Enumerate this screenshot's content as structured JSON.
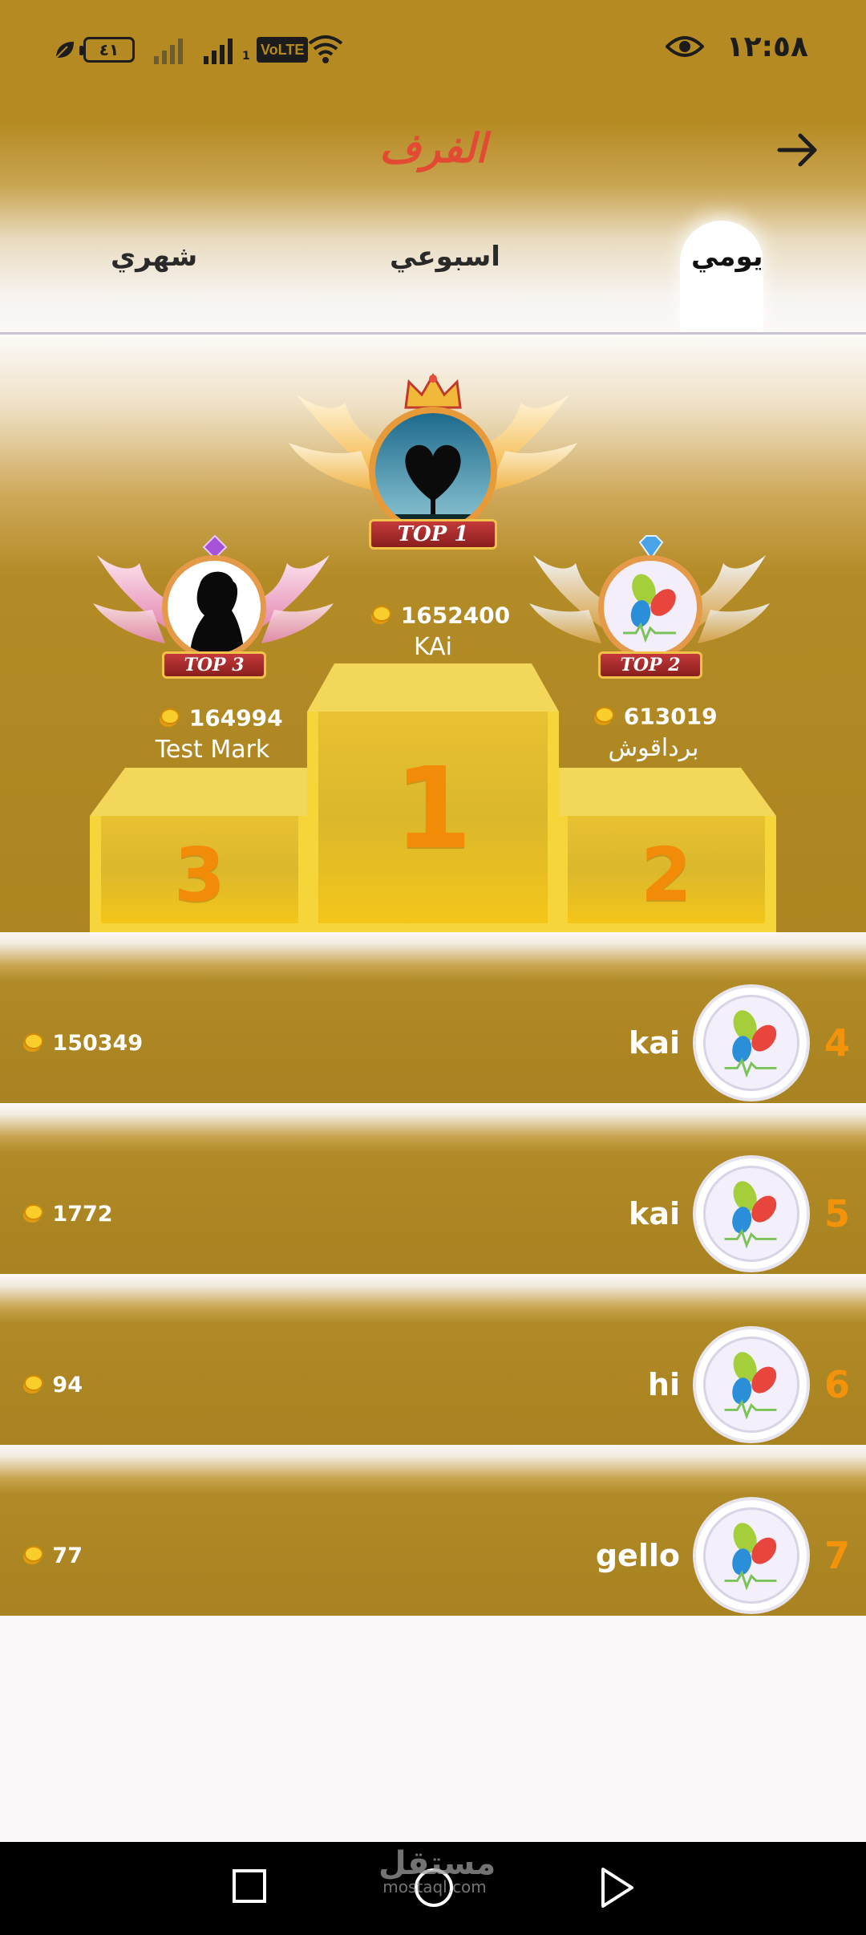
{
  "status_bar": {
    "time": "١٢:٥٨",
    "battery": "٤١",
    "volte": "VoLTE",
    "sim_index": "1"
  },
  "header": {
    "title": "الفرف"
  },
  "tabs": [
    {
      "label": "شهري",
      "selected": false
    },
    {
      "label": "اسبوعي",
      "selected": false
    },
    {
      "label": "يومي",
      "selected": true
    }
  ],
  "podium": {
    "first": {
      "badge": "TOP 1",
      "score": "1652400",
      "name": "KAi",
      "block_label": "1"
    },
    "second": {
      "badge": "TOP 2",
      "score": "613019",
      "name": "برداقوش",
      "block_label": "2"
    },
    "third": {
      "badge": "TOP 3",
      "score": "164994",
      "name": "Test Mark",
      "block_label": "3"
    }
  },
  "ranking": [
    {
      "rank": "4",
      "name": "kai",
      "score": "150349"
    },
    {
      "rank": "5",
      "name": "kai",
      "score": "1772"
    },
    {
      "rank": "6",
      "name": "hi",
      "score": "94"
    },
    {
      "rank": "7",
      "name": "gello",
      "score": "77"
    }
  ],
  "watermark": {
    "text": "مستقل",
    "sub": "mostaql.com"
  },
  "colors": {
    "brand_gold": "#b58a22",
    "title_red": "#e34a33",
    "rank_orange": "#f2930b",
    "podium_yellow": "#f6d53b"
  }
}
